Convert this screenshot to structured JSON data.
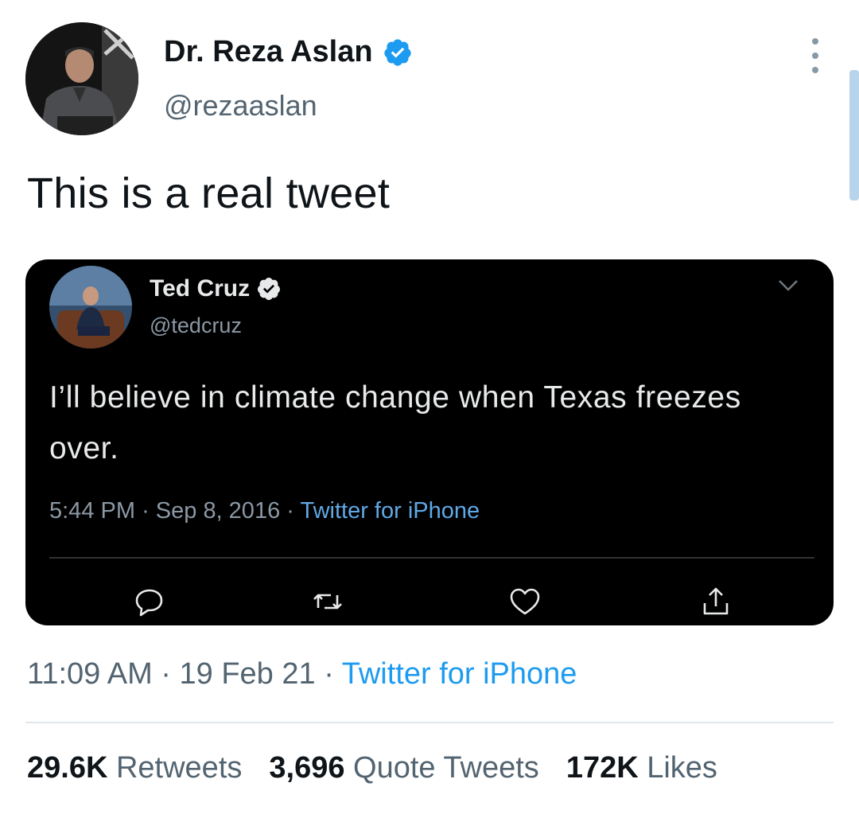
{
  "author": {
    "display_name": "Dr. Reza Aslan",
    "handle": "@rezaaslan",
    "verified_icon": "verified-badge-icon"
  },
  "tweet": {
    "text": "This is a real tweet",
    "time": "11:09 AM",
    "date": "19 Feb 21",
    "source": "Twitter for iPhone"
  },
  "embedded_tweet": {
    "display_name": "Ted Cruz",
    "handle": "@tedcruz",
    "text": "I’ll believe in climate change when Texas freezes over.",
    "time": "5:44 PM",
    "date": "Sep 8, 2016",
    "source": "Twitter for iPhone",
    "actions": [
      "reply-icon",
      "retweet-icon",
      "like-icon",
      "share-icon"
    ]
  },
  "stats": {
    "retweets_count": "29.6K",
    "retweets_label": "Retweets",
    "quotes_count": "3,696",
    "quotes_label": "Quote Tweets",
    "likes_count": "172K",
    "likes_label": "Likes"
  },
  "colors": {
    "accent": "#1d9bf0",
    "secondary_text": "#536471",
    "embedded_background": "#000000"
  }
}
